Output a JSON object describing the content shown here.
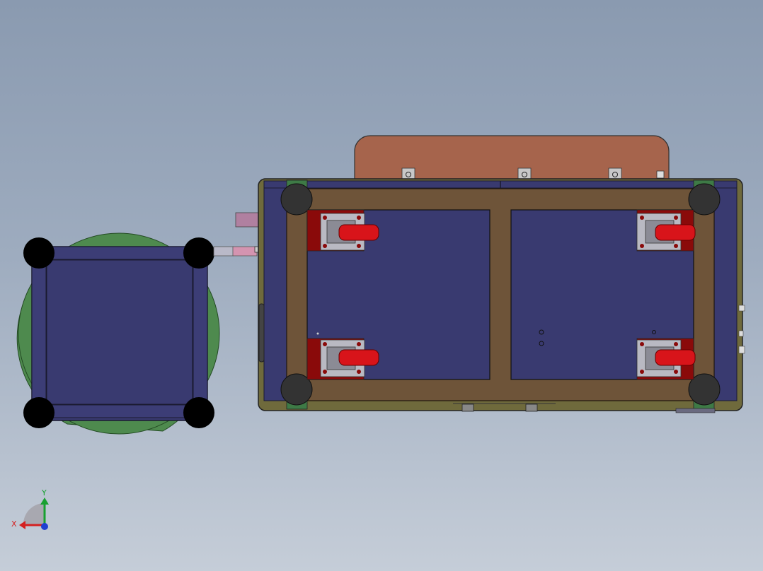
{
  "viewport": {
    "background_top": "#8a9ab0",
    "background_bottom": "#c5cdd8"
  },
  "colors": {
    "frame_panel": "#393a70",
    "frame_edge": "#6f6a3c",
    "wood_beam": "#6e5439",
    "orange_cover": "#a6644c",
    "caster_wheel": "#d8141a",
    "caster_bracket_red": "#8a0a0a",
    "caster_plate": "#b9b9c2",
    "corner_foot": "#333333",
    "round_base": "#4e8a4e",
    "corner_bracket": "#3e7a46",
    "pink_rod": "#d494b0",
    "axis_x": "#d42020",
    "axis_y": "#18a030",
    "axis_z": "#2040d0"
  },
  "orientation_triad": {
    "x_label": "X",
    "y_label": "Y",
    "icon": "axis-triad-icon"
  }
}
